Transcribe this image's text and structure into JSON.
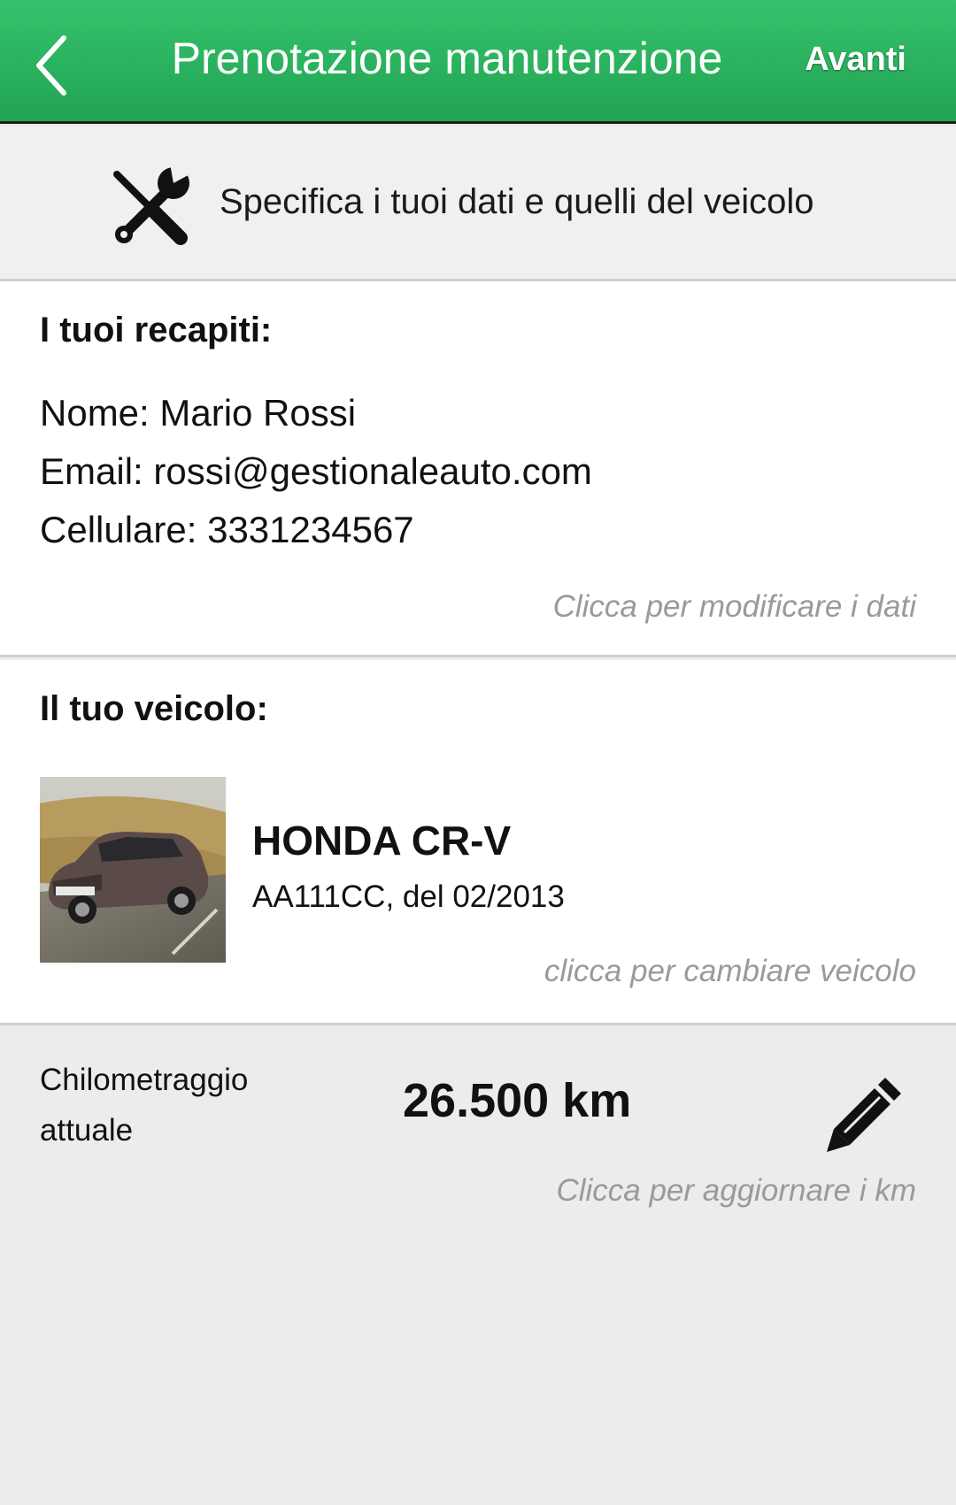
{
  "header": {
    "title": "Prenotazione manutenzione",
    "next_label": "Avanti",
    "accent_color": "#2bb35f",
    "back_icon": "chevron-left-icon"
  },
  "instruction": {
    "icon": "wrench-screwdriver-icon",
    "text": "Specifica i tuoi dati e quelli del veicolo"
  },
  "contacts": {
    "title": "I tuoi recapiti:",
    "lines": [
      "Nome: Mario Rossi",
      "Email: rossi@gestionaleauto.com",
      "Cellulare: 3331234567"
    ],
    "hint": "Clicca per modificare i dati"
  },
  "vehicle": {
    "title": "Il tuo veicolo:",
    "name": "HONDA CR-V",
    "detail": "AA111CC, del 02/2013",
    "hint": "clicca per cambiare veicolo"
  },
  "mileage": {
    "label": "Chilometraggio attuale",
    "value": "26.500 km",
    "edit_icon": "pencil-icon",
    "hint": "Clicca per aggiornare i km"
  }
}
